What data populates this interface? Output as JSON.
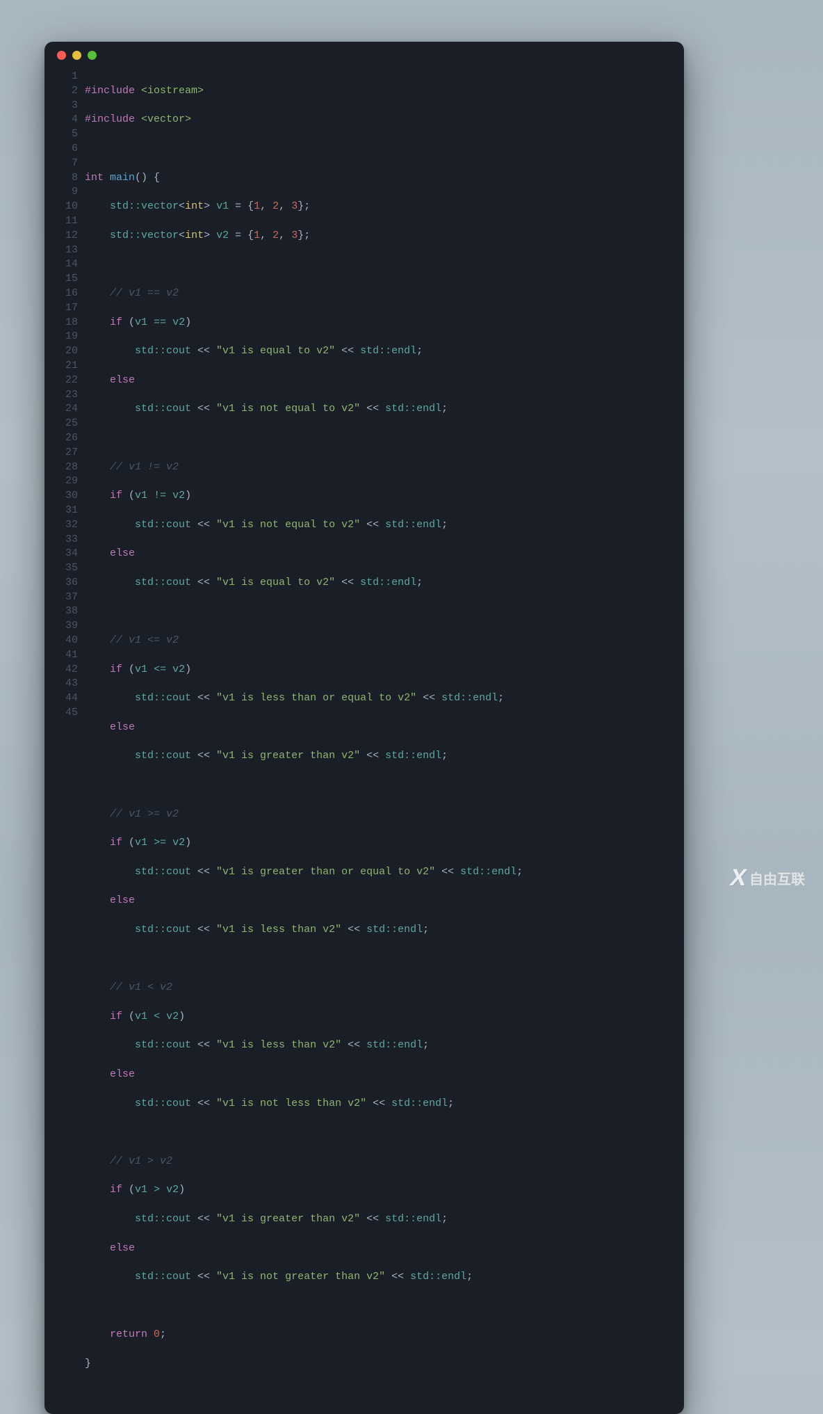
{
  "window": {
    "dots": [
      "red",
      "yellow",
      "green"
    ]
  },
  "line_count": 45,
  "code": {
    "l1": {
      "hash": "#include ",
      "inc": "<iostream>"
    },
    "l2": {
      "hash": "#include ",
      "inc": "<vector>"
    },
    "l4": {
      "kw": "int ",
      "fn": "main",
      "rest": "() {"
    },
    "l5": {
      "indent": "    ",
      "ns1": "std::vector",
      "lt": "<",
      "ty": "int",
      "gt": "> ",
      "var": "v1",
      "eq": " = {",
      "n1": "1",
      "c1": ", ",
      "n2": "2",
      "c2": ", ",
      "n3": "3",
      "end": "};"
    },
    "l6": {
      "indent": "    ",
      "ns1": "std::vector",
      "lt": "<",
      "ty": "int",
      "gt": "> ",
      "var": "v2",
      "eq": " = {",
      "n1": "1",
      "c1": ", ",
      "n2": "2",
      "c2": ", ",
      "n3": "3",
      "end": "};"
    },
    "l8": {
      "cmt": "    // v1 == v2"
    },
    "l9": {
      "indent": "    ",
      "if": "if ",
      "p1": "(",
      "v1": "v1 ",
      "op": "==",
      "v2": " v2",
      "p2": ")"
    },
    "l10": {
      "indent": "        ",
      "cout": "std::cout ",
      "s1": "<< ",
      "str": "\"v1 is equal to v2\"",
      "s2": " << ",
      "endl": "std::endl",
      "semi": ";"
    },
    "l11": {
      "indent": "    ",
      "else": "else"
    },
    "l12": {
      "indent": "        ",
      "cout": "std::cout ",
      "s1": "<< ",
      "str": "\"v1 is not equal to v2\"",
      "s2": " << ",
      "endl": "std::endl",
      "semi": ";"
    },
    "l14": {
      "cmt": "    // v1 != v2"
    },
    "l15": {
      "indent": "    ",
      "if": "if ",
      "p1": "(",
      "v1": "v1 ",
      "op": "!=",
      "v2": " v2",
      "p2": ")"
    },
    "l16": {
      "indent": "        ",
      "cout": "std::cout ",
      "s1": "<< ",
      "str": "\"v1 is not equal to v2\"",
      "s2": " << ",
      "endl": "std::endl",
      "semi": ";"
    },
    "l17": {
      "indent": "    ",
      "else": "else"
    },
    "l18": {
      "indent": "        ",
      "cout": "std::cout ",
      "s1": "<< ",
      "str": "\"v1 is equal to v2\"",
      "s2": " << ",
      "endl": "std::endl",
      "semi": ";"
    },
    "l20": {
      "cmt": "    // v1 <= v2"
    },
    "l21": {
      "indent": "    ",
      "if": "if ",
      "p1": "(",
      "v1": "v1 ",
      "op": "<=",
      "v2": " v2",
      "p2": ")"
    },
    "l22": {
      "indent": "        ",
      "cout": "std::cout ",
      "s1": "<< ",
      "str": "\"v1 is less than or equal to v2\"",
      "s2": " << ",
      "endl": "std::endl",
      "semi": ";"
    },
    "l23": {
      "indent": "    ",
      "else": "else"
    },
    "l24": {
      "indent": "        ",
      "cout": "std::cout ",
      "s1": "<< ",
      "str": "\"v1 is greater than v2\"",
      "s2": " << ",
      "endl": "std::endl",
      "semi": ";"
    },
    "l26": {
      "cmt": "    // v1 >= v2"
    },
    "l27": {
      "indent": "    ",
      "if": "if ",
      "p1": "(",
      "v1": "v1 ",
      "op": ">=",
      "v2": " v2",
      "p2": ")"
    },
    "l28": {
      "indent": "        ",
      "cout": "std::cout ",
      "s1": "<< ",
      "str": "\"v1 is greater than or equal to v2\"",
      "s2": " << ",
      "endl": "std::endl",
      "semi": ";"
    },
    "l29": {
      "indent": "    ",
      "else": "else"
    },
    "l30": {
      "indent": "        ",
      "cout": "std::cout ",
      "s1": "<< ",
      "str": "\"v1 is less than v2\"",
      "s2": " << ",
      "endl": "std::endl",
      "semi": ";"
    },
    "l32": {
      "cmt": "    // v1 < v2"
    },
    "l33": {
      "indent": "    ",
      "if": "if ",
      "p1": "(",
      "v1": "v1 ",
      "op": "<",
      "v2": " v2",
      "p2": ")"
    },
    "l34": {
      "indent": "        ",
      "cout": "std::cout ",
      "s1": "<< ",
      "str": "\"v1 is less than v2\"",
      "s2": " << ",
      "endl": "std::endl",
      "semi": ";"
    },
    "l35": {
      "indent": "    ",
      "else": "else"
    },
    "l36": {
      "indent": "        ",
      "cout": "std::cout ",
      "s1": "<< ",
      "str": "\"v1 is not less than v2\"",
      "s2": " << ",
      "endl": "std::endl",
      "semi": ";"
    },
    "l38": {
      "cmt": "    // v1 > v2"
    },
    "l39": {
      "indent": "    ",
      "if": "if ",
      "p1": "(",
      "v1": "v1 ",
      "op": ">",
      "v2": " v2",
      "p2": ")"
    },
    "l40": {
      "indent": "        ",
      "cout": "std::cout ",
      "s1": "<< ",
      "str": "\"v1 is greater than v2\"",
      "s2": " << ",
      "endl": "std::endl",
      "semi": ";"
    },
    "l41": {
      "indent": "    ",
      "else": "else"
    },
    "l42": {
      "indent": "        ",
      "cout": "std::cout ",
      "s1": "<< ",
      "str": "\"v1 is not greater than v2\"",
      "s2": " << ",
      "endl": "std::endl",
      "semi": ";"
    },
    "l44": {
      "indent": "    ",
      "ret": "return ",
      "zero": "0",
      "semi": ";"
    },
    "l45": {
      "brace": "}"
    }
  },
  "watermark": {
    "x": "X",
    "text": "自由互联"
  }
}
